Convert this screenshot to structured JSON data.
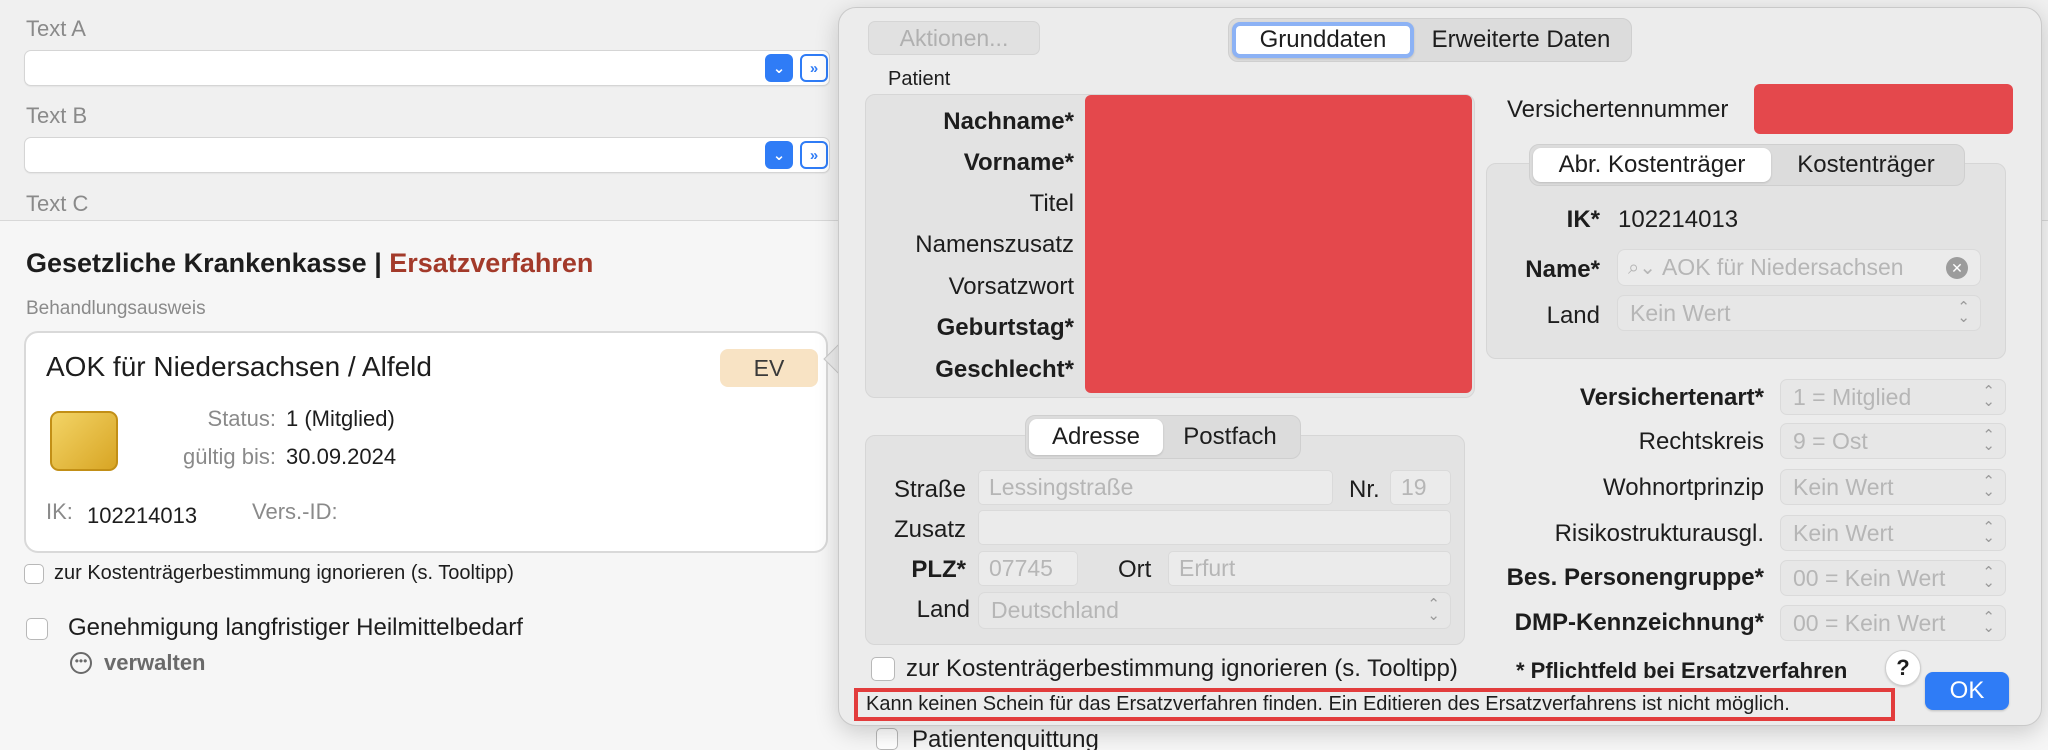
{
  "background": {
    "text_a_label": "Text A",
    "text_b_label": "Text B",
    "text_c_label": "Text C",
    "section_title_main": "Gesetzliche Krankenkasse | ",
    "section_title_accent": "Ersatzverfahren",
    "behandlungsausweis_label": "Behandlungsausweis",
    "card": {
      "title": "AOK für Niedersachsen / Alfeld",
      "badge": "EV",
      "status_label": "Status:",
      "status_value": "1 (Mitglied)",
      "valid_label": "gültig bis:",
      "valid_value": "30.09.2024",
      "ik_label": "IK:",
      "ik_value": "102214013",
      "versid_label": "Vers.-ID:"
    },
    "ignore_checkbox_label": "zur Kostenträgerbestimmung ignorieren (s. Tooltipp)",
    "heilmittel_label": "Genehmigung langfristiger Heilmittelbedarf",
    "verwalten_label": "verwalten",
    "patientenquittung_label": "Patientenquittung"
  },
  "popover": {
    "aktionen_label": "Aktionen...",
    "tabs": [
      "Grunddaten",
      "Erweiterte Daten"
    ],
    "patient_group_label": "Patient",
    "patient_fields": [
      {
        "label": "Nachname*",
        "bold": true
      },
      {
        "label": "Vorname*",
        "bold": true
      },
      {
        "label": "Titel",
        "bold": false
      },
      {
        "label": "Namenszusatz",
        "bold": false
      },
      {
        "label": "Vorsatzwort",
        "bold": false
      },
      {
        "label": "Geburtstag*",
        "bold": true
      },
      {
        "label": "Geschlecht*",
        "bold": true
      }
    ],
    "versichertennummer_label": "Versichertennummer",
    "kosten_tabs": [
      "Abr. Kostenträger",
      "Kostenträger"
    ],
    "ik_label": "IK*",
    "ik_value": "102214013",
    "name_label": "Name*",
    "name_placeholder": "AOK für Niedersachsen",
    "land_label": "Land",
    "land_value": "Kein Wert",
    "address_tabs": [
      "Adresse",
      "Postfach"
    ],
    "strasse_label": "Straße",
    "strasse_placeholder": "Lessingstraße",
    "nr_label": "Nr.",
    "nr_placeholder": "19",
    "zusatz_label": "Zusatz",
    "plz_label": "PLZ*",
    "plz_placeholder": "07745",
    "ort_label": "Ort",
    "ort_placeholder": "Erfurt",
    "addr_land_label": "Land",
    "addr_land_value": "Deutschland",
    "right_fields": [
      {
        "label": "Versichertenart*",
        "value": "1 = Mitglied",
        "bold": true
      },
      {
        "label": "Rechtskreis",
        "value": "9 = Ost",
        "bold": false
      },
      {
        "label": "Wohnortprinzip",
        "value": "Kein Wert",
        "bold": false
      },
      {
        "label": "Risikostrukturausgl.",
        "value": "Kein Wert",
        "bold": false
      },
      {
        "label": "Bes. Personengruppe*",
        "value": "00 = Kein Wert",
        "bold": true
      },
      {
        "label": "DMP-Kennzeichnung*",
        "value": "00 = Kein Wert",
        "bold": true
      }
    ],
    "ignore_checkbox_label": "zur Kostenträgerbestimmung ignorieren (s. Tooltipp)",
    "pflichtfeld_note": "* Pflichtfeld bei Ersatzverfahren",
    "help_label": "?",
    "error_message": "Kann keinen Schein für das Ersatzverfahren finden. Ein Editieren des Ersatzverfahrens ist nicht möglich.",
    "ok_label": "OK"
  }
}
